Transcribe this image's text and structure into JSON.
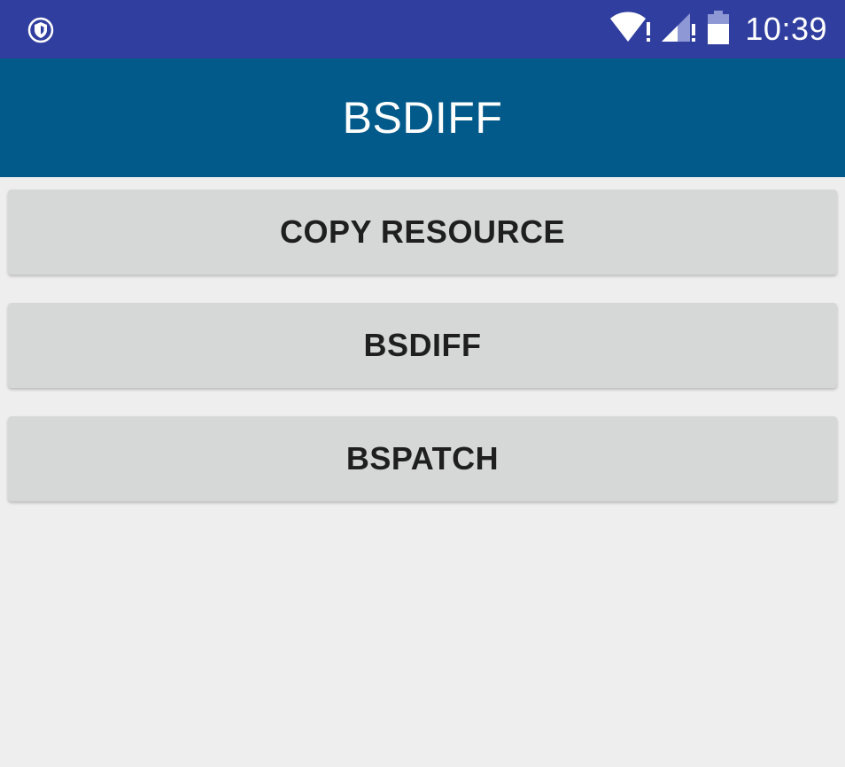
{
  "status_bar": {
    "time": "10:39",
    "icons": [
      "shield-notification-icon",
      "wifi-alert-icon",
      "cell-signal-alert-icon",
      "battery-icon"
    ],
    "background_color": "#303f9f"
  },
  "app_bar": {
    "title": "BSDIFF",
    "background_color": "#025a8a"
  },
  "buttons": [
    {
      "label": "COPY RESOURCE"
    },
    {
      "label": "BSDIFF"
    },
    {
      "label": "BSPATCH"
    }
  ],
  "colors": {
    "page_background": "#eeeeee",
    "button_background": "#d6d7d7",
    "button_text": "#1f1f1f"
  }
}
